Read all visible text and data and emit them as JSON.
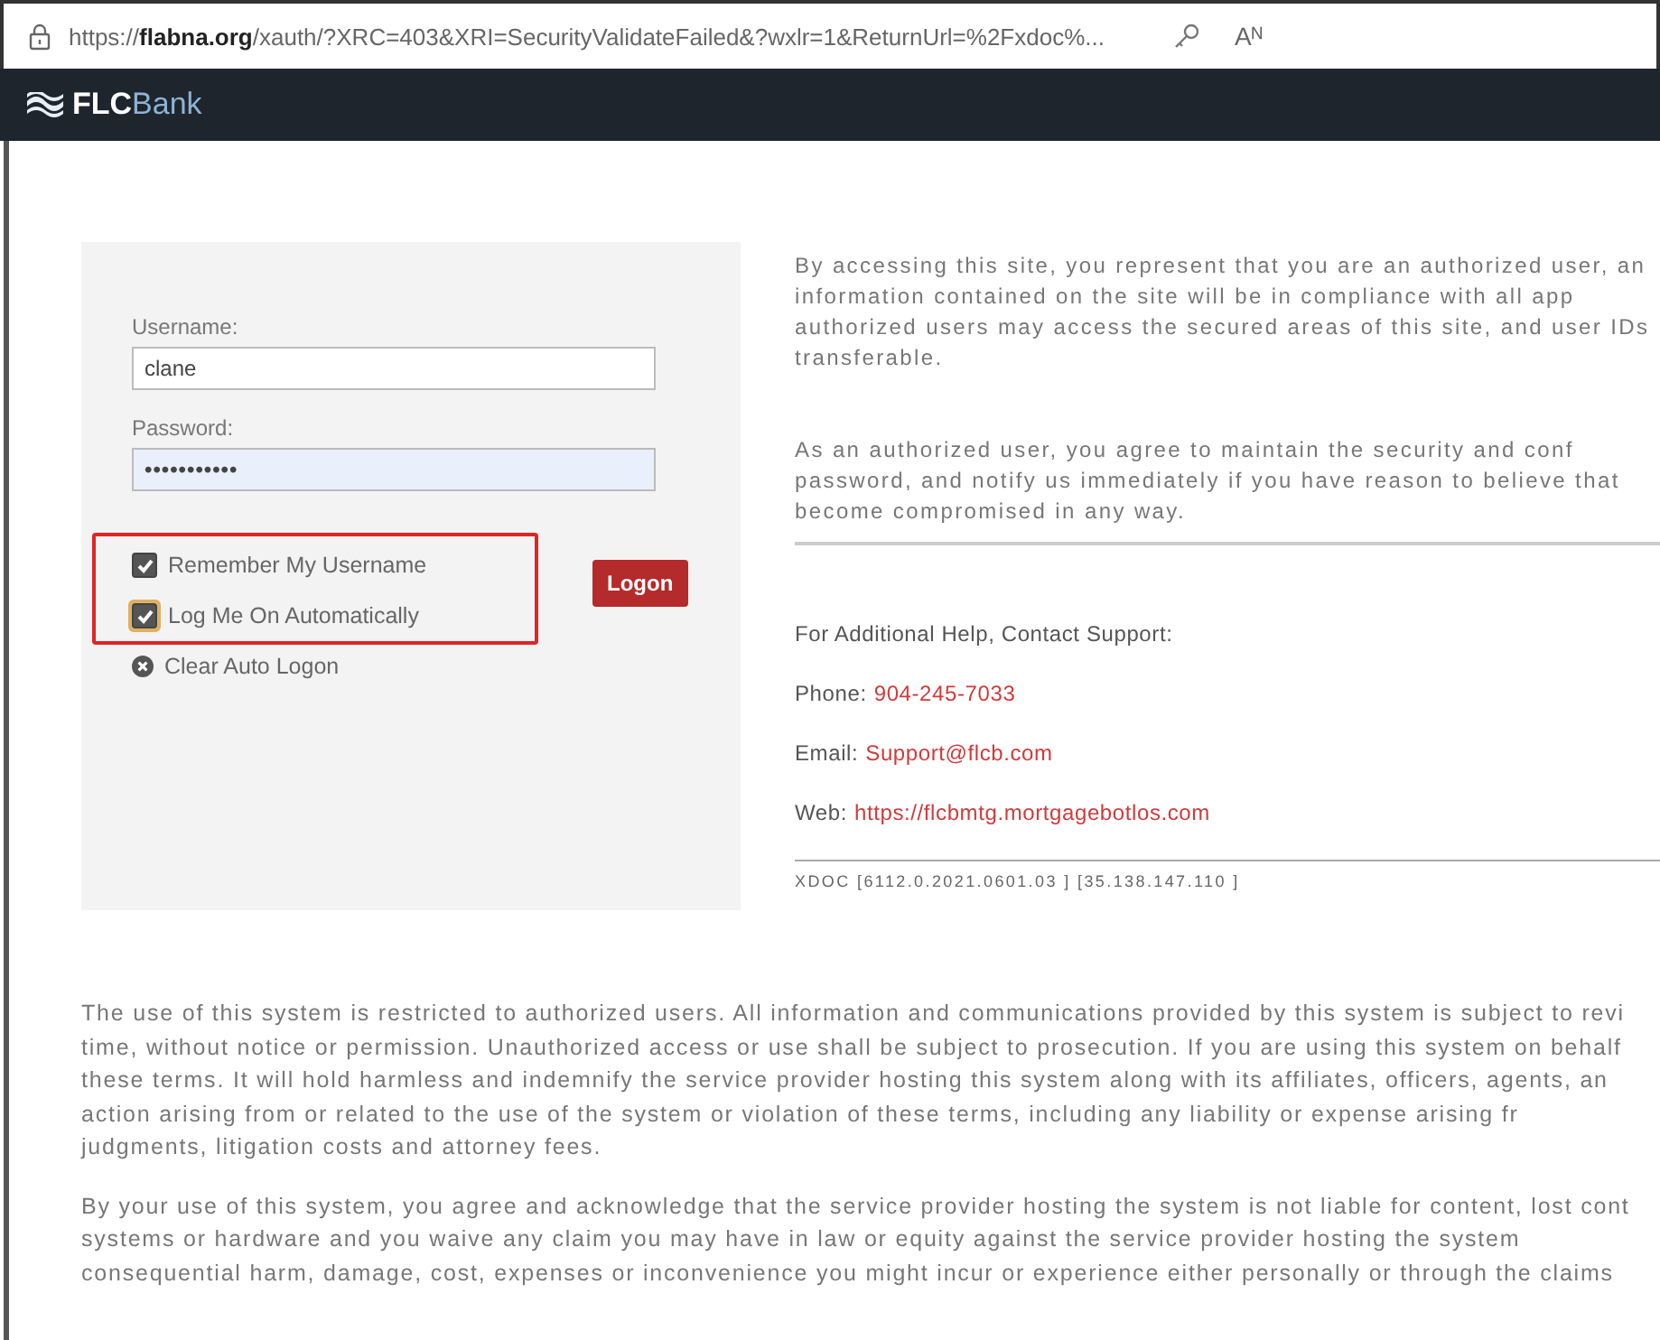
{
  "address_bar": {
    "url": "https://**flabna.org**/xauth/?XRC=403&XRI=SecurityValidateFailed&?wxlr=1&ReturnUrl=%2Fxdoc%...",
    "read_aloud": "Aᴺ"
  },
  "header": {
    "logo": "**FLC**Bank"
  },
  "login": {
    "fields": [
      {
        "label": "Username:",
        "value": "clane",
        "kind": "text",
        "focused": false
      },
      {
        "label": "Password:",
        "value": "•••••••••••",
        "kind": "password",
        "focused": true
      }
    ],
    "options": [
      {
        "label": "Remember My Username",
        "checked": true,
        "focused": false
      },
      {
        "label": "Log Me On Automatically",
        "checked": true,
        "focused": true
      }
    ],
    "logon_button": "Logon",
    "clear_link": "Clear Auto Logon"
  },
  "notice": {
    "paragraphs": [
      [
        "By accessing this site, you represent that you are an authorized user, an",
        "information contained on the site will be in compliance with all app",
        "authorized users may access the secured areas of this site, and user IDs",
        "transferable."
      ],
      [
        "As an authorized user, you agree to maintain the security and conf",
        "password, and notify us immediately if you have reason to believe that",
        "become compromised in any way."
      ]
    ]
  },
  "support": {
    "heading": "For Additional Help, Contact Support:",
    "contacts": [
      {
        "label": "Phone:",
        "value": "904-245-7033"
      },
      {
        "label": "Email:",
        "value": "Support@flcb.com"
      },
      {
        "label": "Web:",
        "value": "https://flcbmtg.mortgagebotlos.com"
      }
    ],
    "version": "XDOC  [6112.0.2021.0601.03 ]  [35.138.147.110 ]"
  },
  "terms": [
    [
      "The use of this system is restricted to authorized users. All information and communications provided by this system is subject to revi",
      "time, without notice or permission. Unauthorized access or use shall be subject to prosecution. If you are using this system on behalf",
      "these terms. It will hold harmless and indemnify the service provider hosting this system along with its affiliates, officers, agents, an",
      "action arising from or related to the use of the system or violation of these terms, including any liability or expense arising fr",
      "judgments, litigation costs and attorney fees."
    ],
    [
      "By your use of this system, you agree and acknowledge that the service provider hosting the system is not liable for content, lost cont",
      "systems or hardware and you waive any claim you may have in law or equity against the service provider hosting the system",
      "consequential harm, damage, cost, expenses or inconvenience you might incur or experience either personally or through the claims"
    ]
  ]
}
